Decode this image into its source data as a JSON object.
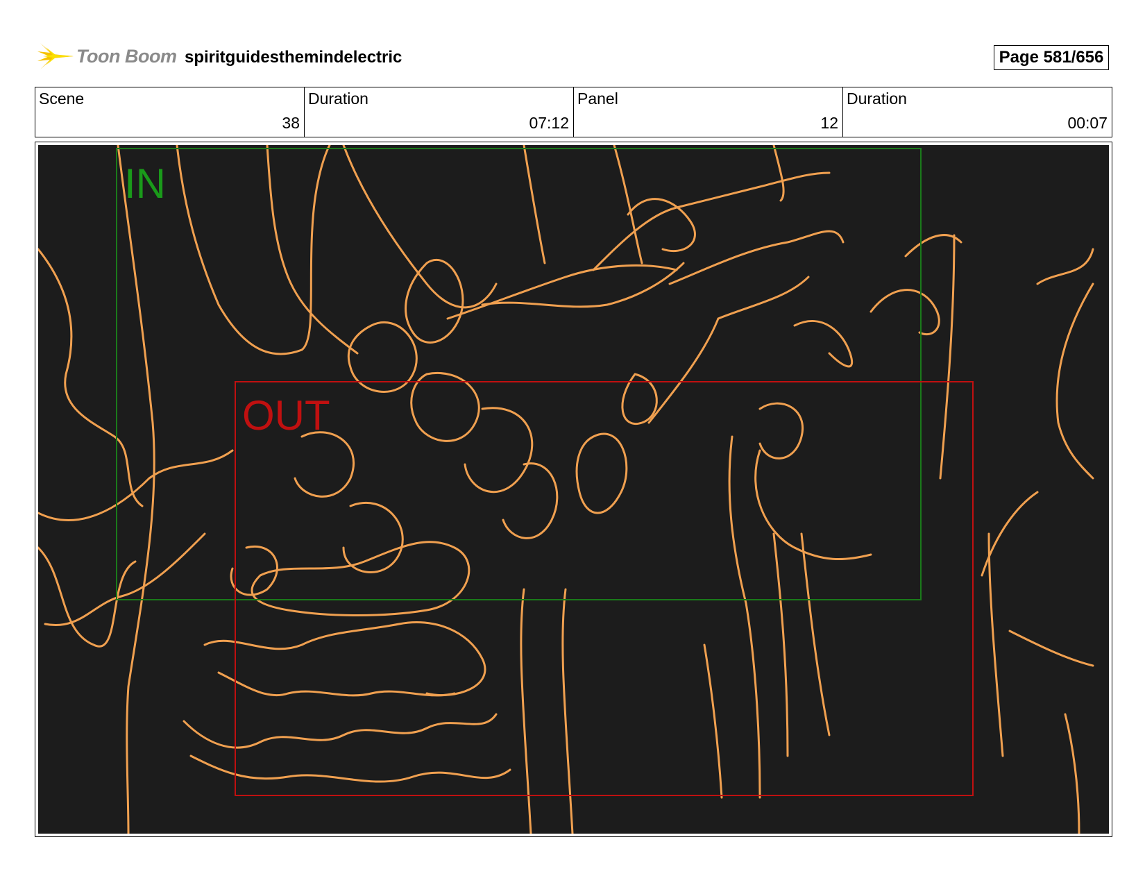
{
  "header": {
    "logo_text": "Toon Boom",
    "project_title": "spiritguidesthemindelectric",
    "page": "Page 581/656"
  },
  "info": {
    "scene_label": "Scene",
    "scene_value": "38",
    "scene_duration_label": "Duration",
    "scene_duration_value": "07:12",
    "panel_label": "Panel",
    "panel_value": "12",
    "panel_duration_label": "Duration",
    "panel_duration_value": "00:07"
  },
  "frame": {
    "in_label": "IN",
    "out_label": "OUT",
    "in_color": "#1a7a1a",
    "out_color": "#c01010",
    "sketch_color": "#f0a050",
    "background": "#1c1c1c"
  }
}
